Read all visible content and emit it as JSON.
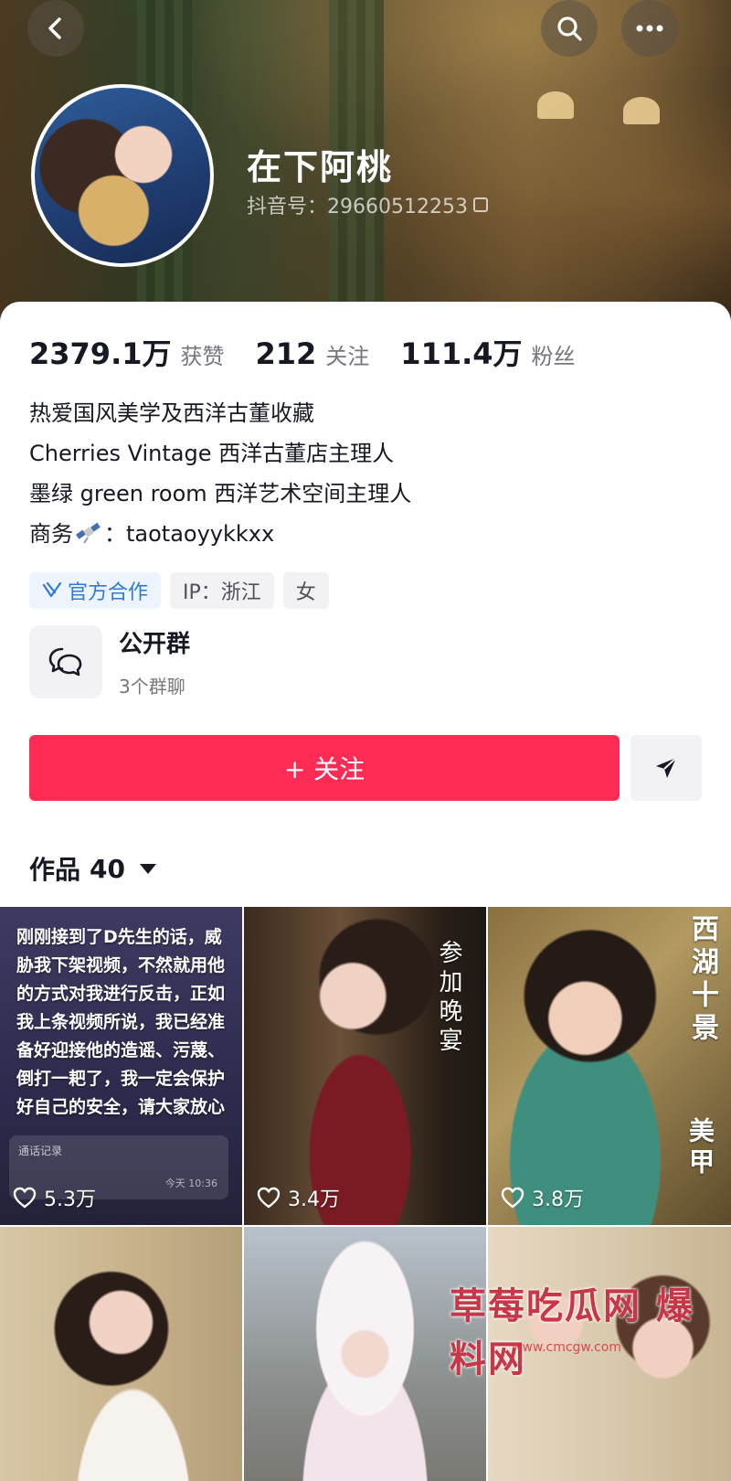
{
  "header": {
    "name": "在下阿桃",
    "douyin_id": "抖音号：29660512253"
  },
  "stats": [
    {
      "value": "2379.1万",
      "label": "获赞"
    },
    {
      "value": "212",
      "label": "关注"
    },
    {
      "value": "111.4万",
      "label": "粉丝"
    }
  ],
  "bio": {
    "line1": "热爱国风美学及西洋古董收藏",
    "line2": "Cherries Vintage 西洋古董店主理人",
    "line3": "墨绿 green room 西洋艺术空间主理人",
    "line4_prefix": "商务",
    "line4_suffix": "：taotaoyykkxx"
  },
  "tags": {
    "official": "官方合作",
    "ip": "IP：浙江",
    "gender": "女"
  },
  "group": {
    "title": "公开群",
    "subtitle": "3个群聊"
  },
  "actions": {
    "follow_label": "+ 关注"
  },
  "works": {
    "label": "作品",
    "count": "40"
  },
  "videos": [
    {
      "likes": "5.3万",
      "overlay": "刚刚接到了D先生的话，威胁我下架视频，不然就用他的方式对我进行反击，正如我上条视频所说，我已经准备好迎接他的造谣、污蔑、倒打一耙了，我一定会保护好自己的安全，请大家放心",
      "record_title": "通话记录",
      "record_time": "今天 10:36"
    },
    {
      "likes": "3.4万",
      "vertical_text": "参加晚宴"
    },
    {
      "likes": "3.8万",
      "vertical_text_top": "西湖十景",
      "vertical_text_bottom": "美甲"
    },
    {
      "likes": ""
    },
    {
      "likes": ""
    },
    {
      "likes": ""
    }
  ],
  "watermark": {
    "text": "草莓吃瓜网 爆料网",
    "url": "www.cmcgw.com"
  },
  "colors": {
    "accent": "#fe2c55",
    "official_blue": "#2f7ad6"
  }
}
